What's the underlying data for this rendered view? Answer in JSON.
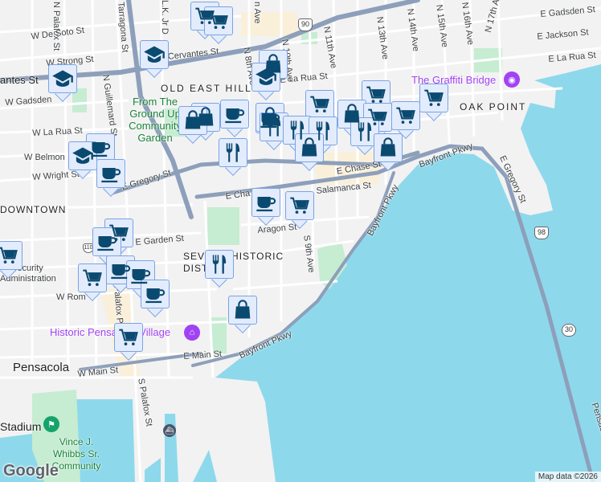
{
  "colors": {
    "water": "#8ed8ec",
    "land": "#f2f2f2",
    "park": "#c6ecd2",
    "highway": "#8d9fba",
    "marker_fill": "#e3ecfc",
    "marker_border": "#7aa3e5",
    "icon": "#0b4a70"
  },
  "labels": [
    "N Palafox St",
    "W De Soto St",
    "W Strong St",
    "antes St",
    "W Gadsden",
    "W La Rua St",
    "W Belmon",
    "W Wright St",
    "N Guillemard St",
    "Tarragona St",
    "E Cervantes St",
    "N 8th Ave",
    "n Ave",
    "N 11th Ave",
    "N 13th Ave",
    "N 14th Ave",
    "N 15th Ave",
    "N 16th Ave",
    "N 17th Ave",
    "E Gadsden St",
    "E Jackson St",
    "E La Rua St",
    "E La Rua St",
    "OLD EAST HILL",
    "OAK POINT",
    "The Graffiti Bridge",
    "From The Ground Up Community Garden",
    "DOWNTOWN",
    "E Gregory St",
    "E Cha",
    "E Chase St",
    "Salamanca St",
    "Aragon St",
    "S 9th Ave",
    "SEVILLE HISTORIC DISTRICT",
    "E Garden St",
    "ial Security Administration",
    "W Rom",
    "Historic Pensacola Village",
    "E Main St",
    "Bayfront Pkwy",
    "Bayfront Pkwy",
    "Bayfront Pkwy",
    "E Gregory St",
    "Pensacola",
    "W Main St",
    "S Palafox St",
    "Stadium",
    "Vince J. Whibbs Sr. Community",
    "Pensacola",
    "L.K. Jr D",
    "N 10th Ave",
    "S Palafox Pl",
    "10th Ave"
  ],
  "shields": [
    "90",
    "98",
    "30",
    "110"
  ],
  "attribution": "Map data ©2026",
  "logo": "Google",
  "marker_types": [
    "shopping-cart",
    "shopping-bag",
    "coffee-cup",
    "restaurant",
    "school"
  ]
}
